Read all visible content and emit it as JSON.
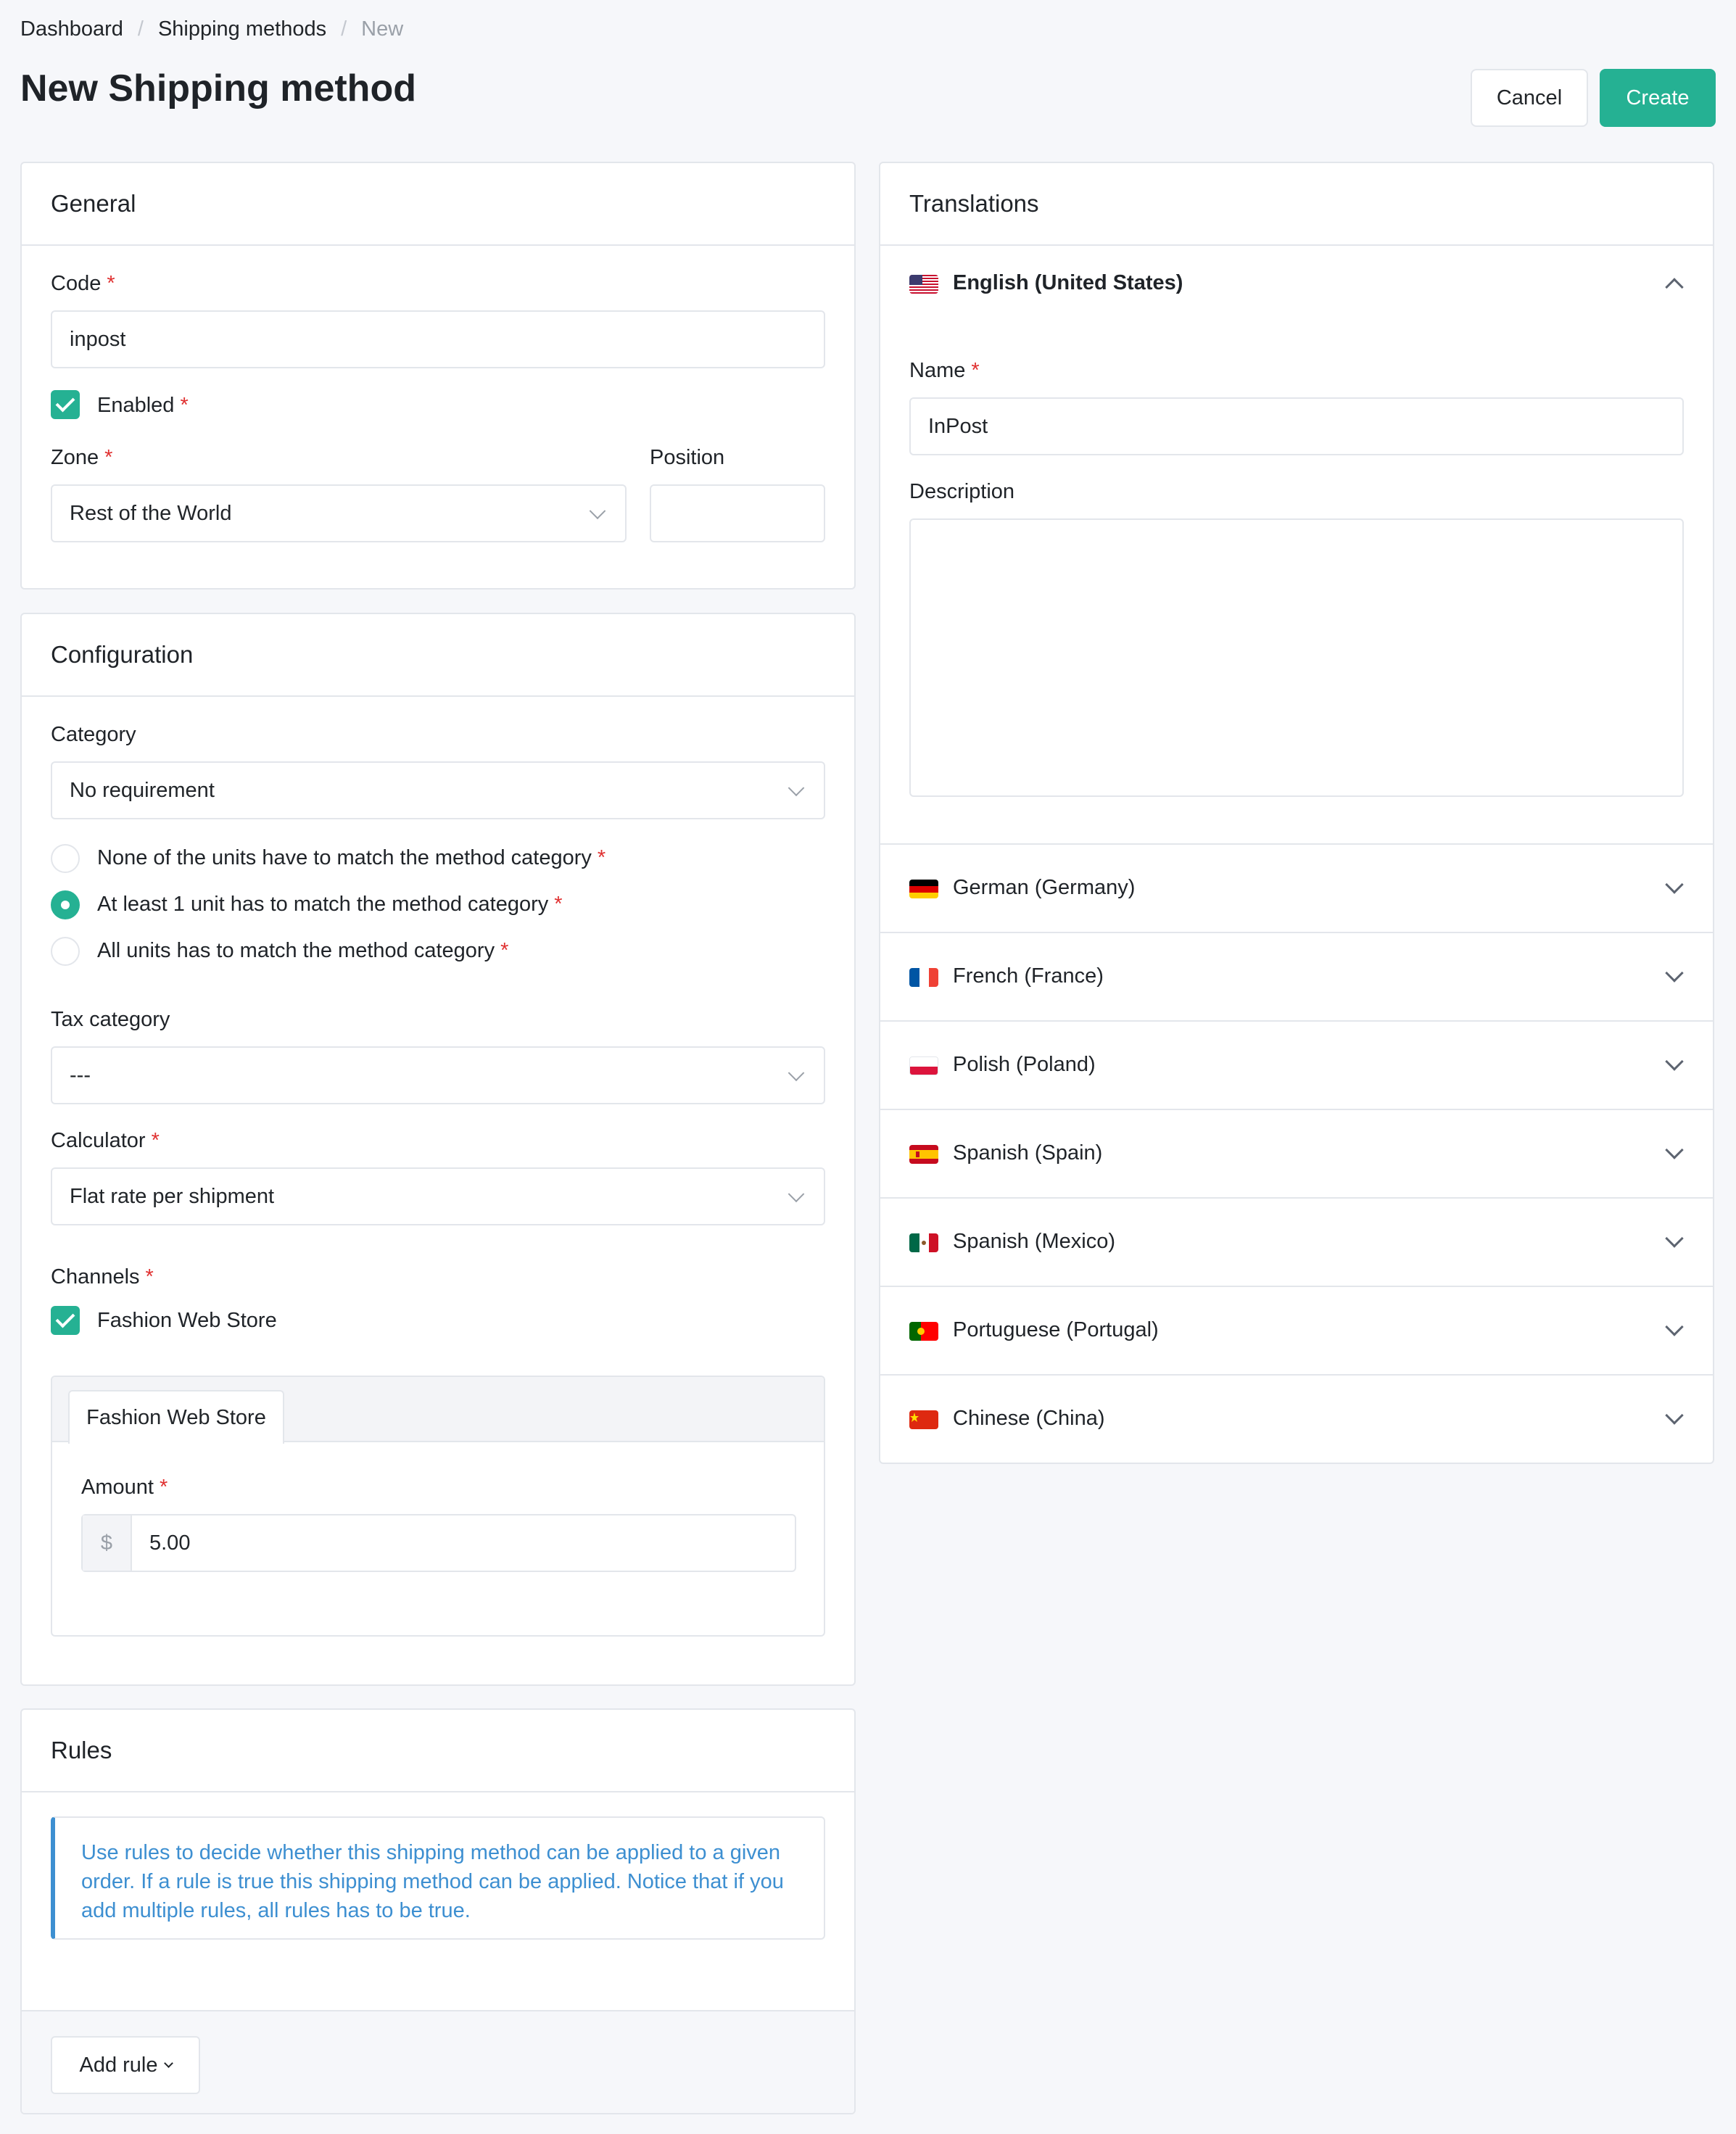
{
  "breadcrumb": {
    "items": [
      "Dashboard",
      "Shipping methods"
    ],
    "current": "New"
  },
  "page": {
    "title": "New Shipping method"
  },
  "actions": {
    "cancel": "Cancel",
    "create": "Create"
  },
  "general": {
    "title": "General",
    "code_label": "Code",
    "code_value": "inpost",
    "enabled_label": "Enabled",
    "zone_label": "Zone",
    "zone_value": "Rest of the World",
    "position_label": "Position",
    "position_value": ""
  },
  "configuration": {
    "title": "Configuration",
    "category_label": "Category",
    "category_value": "No requirement",
    "category_options": [
      "None of the units have to match the method category",
      "At least 1 unit has to match the method category",
      "All units has to match the method category"
    ],
    "tax_category_label": "Tax category",
    "tax_category_value": "---",
    "calculator_label": "Calculator",
    "calculator_value": "Flat rate per shipment",
    "channels_label": "Channels",
    "channel_name": "Fashion Web Store",
    "channel_tab": "Fashion Web Store",
    "amount_label": "Amount",
    "currency": "$",
    "amount_value": "5.00"
  },
  "rules": {
    "title": "Rules",
    "info": "Use rules to decide whether this shipping method can be applied to a given order. If a rule is true this shipping method can be applied. Notice that if you add multiple rules, all rules has to be true.",
    "add_rule": "Add rule"
  },
  "translations": {
    "title": "Translations",
    "active_locale": "English (United States)",
    "name_label": "Name",
    "name_value": "InPost",
    "description_label": "Description",
    "description_value": "",
    "locales": [
      "German (Germany)",
      "French (France)",
      "Polish (Poland)",
      "Spanish (Spain)",
      "Spanish (Mexico)",
      "Portuguese (Portugal)",
      "Chinese (China)"
    ]
  },
  "colors": {
    "accent": "#25b193",
    "required": "#e03131",
    "info_text": "#3d8fd1",
    "info_border": "#3d8fd1"
  }
}
